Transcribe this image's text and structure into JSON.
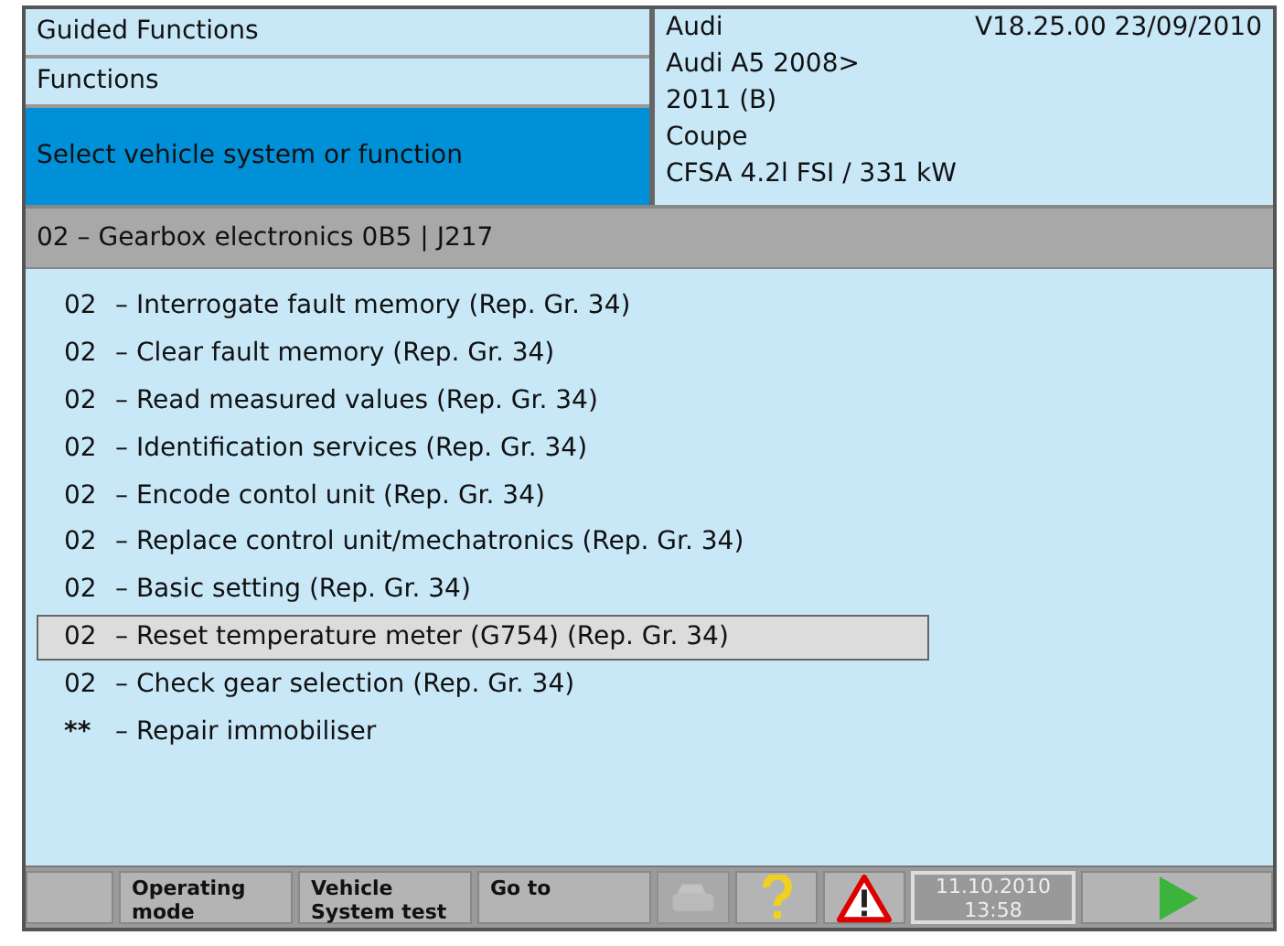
{
  "header": {
    "breadcrumbs": [
      {
        "label": "Guided Functions",
        "selected": false
      },
      {
        "label": "Functions",
        "selected": false
      },
      {
        "label": "Select vehicle system or function",
        "selected": true
      }
    ],
    "vehicle": {
      "make": "Audi",
      "version": "V18.25.00 23/09/2010",
      "lines": [
        "Audi A5 2008>",
        "2011 (B)",
        "Coupe",
        "CFSA 4.2l FSI / 331 kW"
      ]
    }
  },
  "system_bar": "02 – Gearbox electronics 0B5 | J217",
  "functions": [
    {
      "code": "02",
      "kind": "function",
      "text": "– Interrogate fault memory (Rep. Gr. 34)",
      "selected": false
    },
    {
      "code": "02",
      "kind": "function",
      "text": "– Clear fault memory (Rep. Gr. 34)",
      "selected": false
    },
    {
      "code": "02",
      "kind": "function",
      "text": "– Read measured values (Rep. Gr. 34)",
      "selected": false
    },
    {
      "code": "02",
      "kind": "function",
      "text": "– Identification services (Rep. Gr. 34)",
      "selected": false
    },
    {
      "code": "02",
      "kind": "function",
      "text": "– Encode contol unit (Rep. Gr. 34)",
      "selected": false
    },
    {
      "code": "02",
      "kind": "function",
      "text": "– Replace control unit/mechatronics (Rep. Gr. 34)",
      "selected": false
    },
    {
      "code": "02",
      "kind": "function",
      "text": "– Basic setting (Rep. Gr. 34)",
      "selected": false
    },
    {
      "code": "02",
      "kind": "function",
      "text": "– Reset temperature meter (G754) (Rep. Gr. 34)",
      "selected": true
    },
    {
      "code": "02",
      "kind": "function",
      "text": "– Check gear selection (Rep. Gr. 34)",
      "selected": false
    },
    {
      "code": "**",
      "kind": "marker",
      "text": "– Repair immobiliser",
      "selected": false
    }
  ],
  "toolbar": [
    {
      "kind": "blank"
    },
    {
      "kind": "text",
      "label": "Operating\nmode"
    },
    {
      "kind": "text",
      "label": "Vehicle\nSystem test"
    },
    {
      "kind": "text",
      "label": "Go to"
    },
    {
      "kind": "printer",
      "disabled": true
    },
    {
      "kind": "help"
    },
    {
      "kind": "warning"
    },
    {
      "kind": "clock",
      "date": "11.10.2010",
      "time": "13:58"
    },
    {
      "kind": "play"
    }
  ]
}
